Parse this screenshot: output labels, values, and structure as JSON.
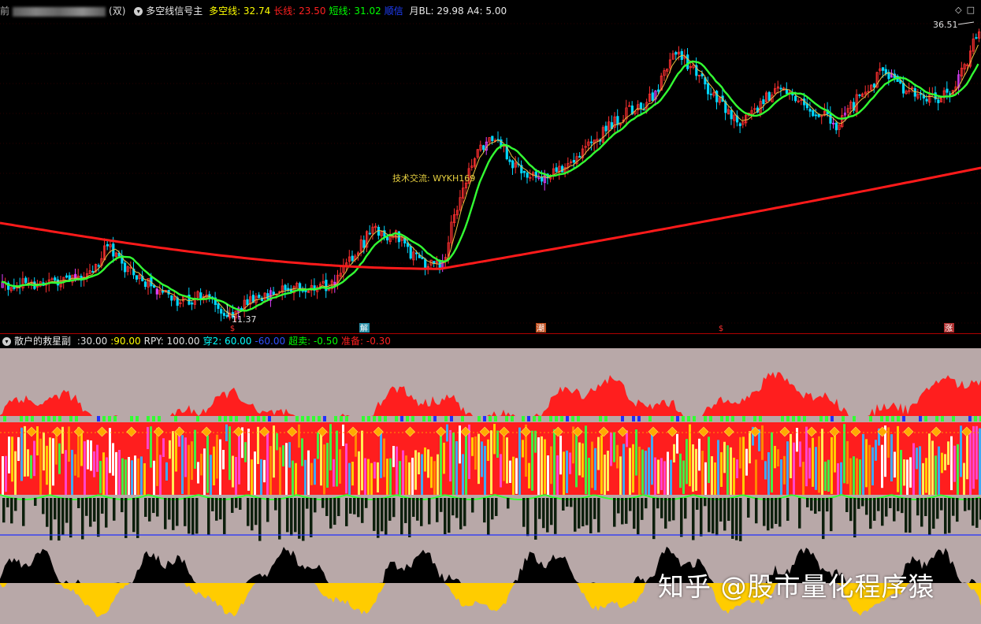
{
  "main_legend": {
    "prefix_fragment": "前",
    "blurred_fragment": "某股票",
    "close_paren": "(双)",
    "indicator_name": "多空线信号主",
    "items": [
      {
        "label": "多空线:",
        "value": "32.74",
        "color": "#ffff00"
      },
      {
        "label": "长线:",
        "value": "23.50",
        "color": "#ff2020"
      },
      {
        "label": "短线:",
        "value": "31.02",
        "color": "#00ff00"
      },
      {
        "label": "顺信",
        "value": "",
        "color": "#2040ff"
      },
      {
        "label": "月BL:",
        "value": "29.98",
        "color": "#e8e8e8"
      },
      {
        "label": "A4:",
        "value": "5.00",
        "color": "#e8e8e8"
      }
    ]
  },
  "sub_legend": {
    "indicator_name": "散户的救星副",
    "items": [
      {
        "label": ":",
        "value": "30.00",
        "color": "#e0e0e0"
      },
      {
        "label": ":",
        "value": "90.00",
        "color": "#ffff00"
      },
      {
        "label": "RPY:",
        "value": "100.00",
        "color": "#e0e0e0"
      },
      {
        "label": "穿2:",
        "value": "60.00",
        "color": "#00ffff"
      },
      {
        "label": "",
        "value": "-60.00",
        "color": "#3050ff"
      },
      {
        "label": "超卖:",
        "value": "-0.50",
        "color": "#00ff00"
      },
      {
        "label": "准备:",
        "value": "-0.30",
        "color": "#ff2020"
      }
    ]
  },
  "annotations": {
    "high_price": "36.51",
    "low_price": "11.37",
    "tech_exchange": "技术交流: WYKH169",
    "signals": [
      {
        "text": "$",
        "color": "#ff3030",
        "bg": ""
      },
      {
        "text": "解",
        "color": "#ffffff",
        "bg": "#2a8fa8"
      },
      {
        "text": "潮",
        "color": "#ffffff",
        "bg": "#c05020"
      },
      {
        "text": "$",
        "color": "#ff3030",
        "bg": ""
      },
      {
        "text": "涨",
        "color": "#ffffff",
        "bg": "#b03030"
      }
    ]
  },
  "watermark": "知乎 @股市量化程序猿",
  "colors": {
    "bg": "#000000",
    "candle_up": "#ff3030",
    "candle_down": "#00d8ff",
    "candle_special": "#e040ff",
    "long_ma": "#ff1a1a",
    "short_ma": "#33ff33",
    "mid_ma": "#e8c040",
    "sub_bg": "#b8a8a8",
    "red_area": "#ff1e1e",
    "yellow_area": "#ffcc00"
  },
  "icons": [
    "collapse-icon",
    "diamond-icon",
    "square-icon",
    "maximize-icon"
  ],
  "chart_data": {
    "type": "candlestick",
    "title": "多空线信号主",
    "y_range": [
      11.37,
      36.51
    ],
    "series": [
      {
        "name": "多空线",
        "value": 32.74
      },
      {
        "name": "长线",
        "value": 23.5
      },
      {
        "name": "短线",
        "value": 31.02
      }
    ],
    "high_label": 36.51,
    "low_label": 11.37
  }
}
